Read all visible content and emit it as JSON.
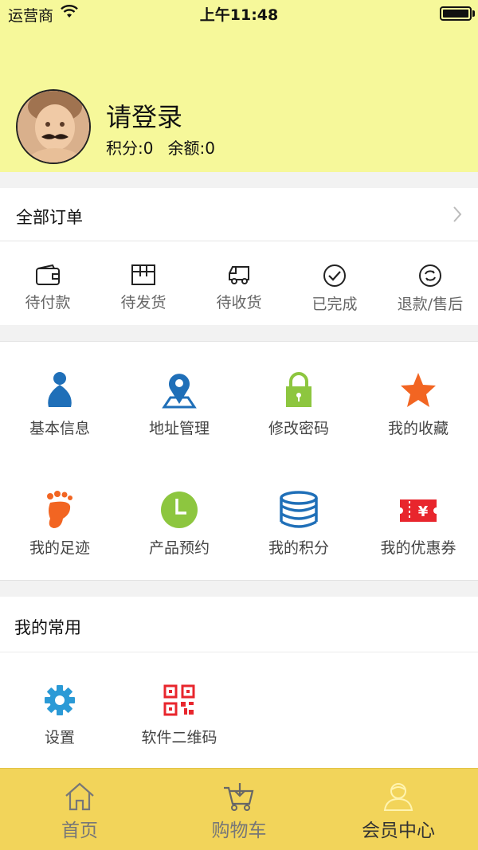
{
  "status_bar": {
    "carrier": "运营商",
    "time": "上午11:48"
  },
  "profile": {
    "title": "请登录",
    "points": "积分:0",
    "balance": "余额:0"
  },
  "orders": {
    "title": "全部订单",
    "items": [
      {
        "label": "待付款",
        "icon": "wallet-icon"
      },
      {
        "label": "待发货",
        "icon": "package-icon"
      },
      {
        "label": "待收货",
        "icon": "truck-icon"
      },
      {
        "label": "已完成",
        "icon": "check-circle-icon"
      },
      {
        "label": "退款/售后",
        "icon": "refund-icon"
      }
    ]
  },
  "tools": [
    {
      "label": "基本信息",
      "icon": "person-icon",
      "color": "#1f6fb8"
    },
    {
      "label": "地址管理",
      "icon": "location-pin-icon",
      "color": "#1f6fb8"
    },
    {
      "label": "修改密码",
      "icon": "lock-icon",
      "color": "#8dc63f"
    },
    {
      "label": "我的收藏",
      "icon": "star-icon",
      "color": "#f26522"
    },
    {
      "label": "我的足迹",
      "icon": "footprint-icon",
      "color": "#f26522"
    },
    {
      "label": "产品预约",
      "icon": "clock-icon",
      "color": "#8dc63f"
    },
    {
      "label": "我的积分",
      "icon": "coins-stack-icon",
      "color": "#1f6fb8"
    },
    {
      "label": "我的优惠券",
      "icon": "coupon-icon",
      "color": "#e8262d"
    }
  ],
  "common": {
    "title": "我的常用",
    "items": [
      {
        "label": "设置",
        "icon": "gear-icon",
        "color": "#2b9ad6"
      },
      {
        "label": "软件二维码",
        "icon": "qr-code-icon",
        "color": "#e8262d"
      }
    ]
  },
  "tabbar": {
    "items": [
      {
        "label": "首页",
        "icon": "home-icon"
      },
      {
        "label": "购物车",
        "icon": "cart-icon"
      },
      {
        "label": "会员中心",
        "icon": "member-icon"
      }
    ],
    "active": "会员中心",
    "background": "#f2d45a"
  },
  "colors": {
    "header_bg": "#f6f89a"
  }
}
